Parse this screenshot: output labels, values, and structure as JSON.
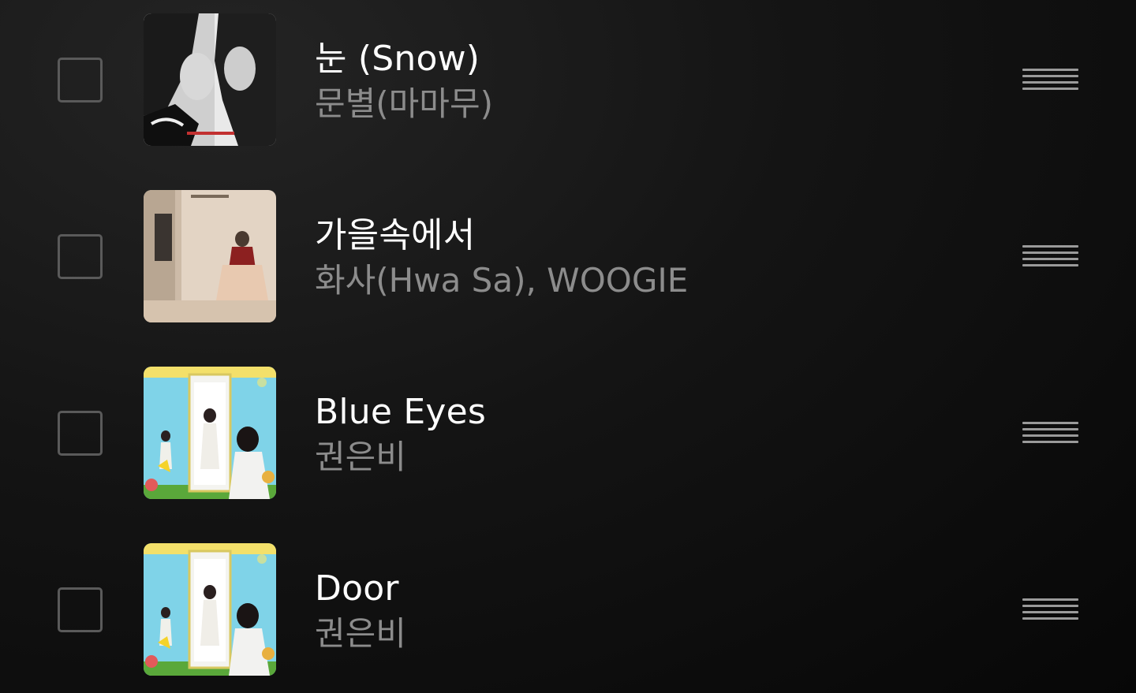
{
  "tracks": [
    {
      "title": "눈 (Snow)",
      "artist": "문별(마마무)",
      "checked": false,
      "art": "snow-cover"
    },
    {
      "title": "가을속에서",
      "artist": "화사(Hwa Sa), WOOGIE",
      "checked": false,
      "art": "autumn-cover"
    },
    {
      "title": "Blue Eyes",
      "artist": "권은비",
      "checked": false,
      "art": "door-cover"
    },
    {
      "title": "Door",
      "artist": "권은비",
      "checked": false,
      "art": "door-cover"
    }
  ],
  "icons": {
    "drag_handle": "drag-handle-icon",
    "checkbox": "checkbox-icon"
  },
  "colors": {
    "title": "#ffffff",
    "artist": "#8c8c8c",
    "checkbox_border": "#5a5a5a",
    "handle": "#9a9a9a"
  }
}
